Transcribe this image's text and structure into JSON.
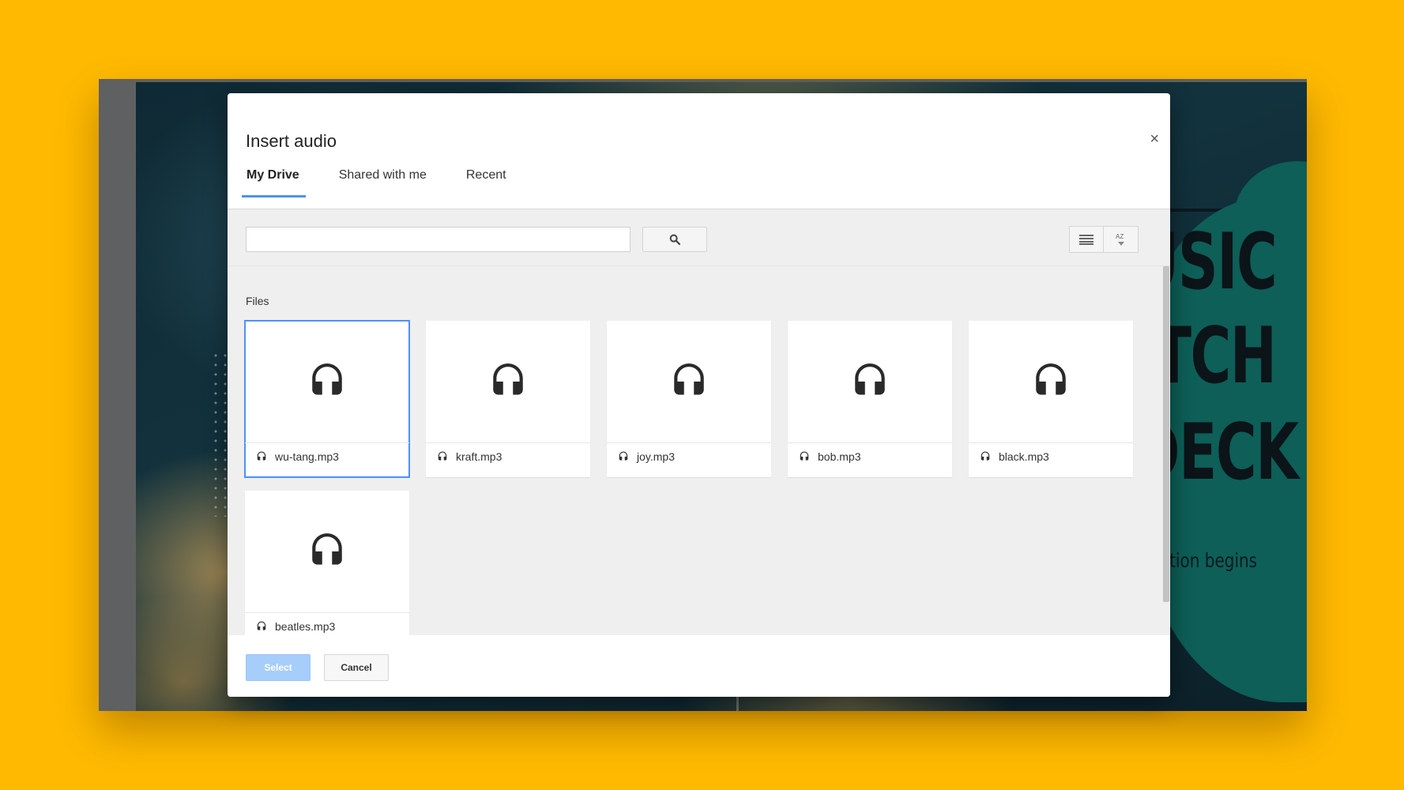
{
  "background": {
    "page_color": "#FFBA00",
    "accent_teal": "#0d5f58"
  },
  "slide": {
    "lines": [
      "USIC",
      "ITCH",
      "DECK"
    ],
    "subtitle": "entation begins"
  },
  "dialog": {
    "title": "Insert audio",
    "close_label": "×",
    "tabs": [
      {
        "label": "My Drive",
        "active": true
      },
      {
        "label": "Shared with me",
        "active": false
      },
      {
        "label": "Recent",
        "active": false
      }
    ],
    "search": {
      "value": "",
      "placeholder": ""
    },
    "icons": {
      "search": "search-icon",
      "list_view": "list-view-icon",
      "sort": "sort-az-icon",
      "file": "headphones-icon",
      "sort_label": "AZ"
    },
    "section_label": "Files",
    "files": [
      {
        "name": "wu-tang.mp3",
        "selected": true
      },
      {
        "name": "kraft.mp3",
        "selected": false
      },
      {
        "name": "joy.mp3",
        "selected": false
      },
      {
        "name": "bob.mp3",
        "selected": false
      },
      {
        "name": "black.mp3",
        "selected": false
      },
      {
        "name": "beatles.mp3",
        "selected": false
      }
    ],
    "buttons": {
      "select": "Select",
      "cancel": "Cancel"
    },
    "accent_color": "#4d90fe"
  }
}
